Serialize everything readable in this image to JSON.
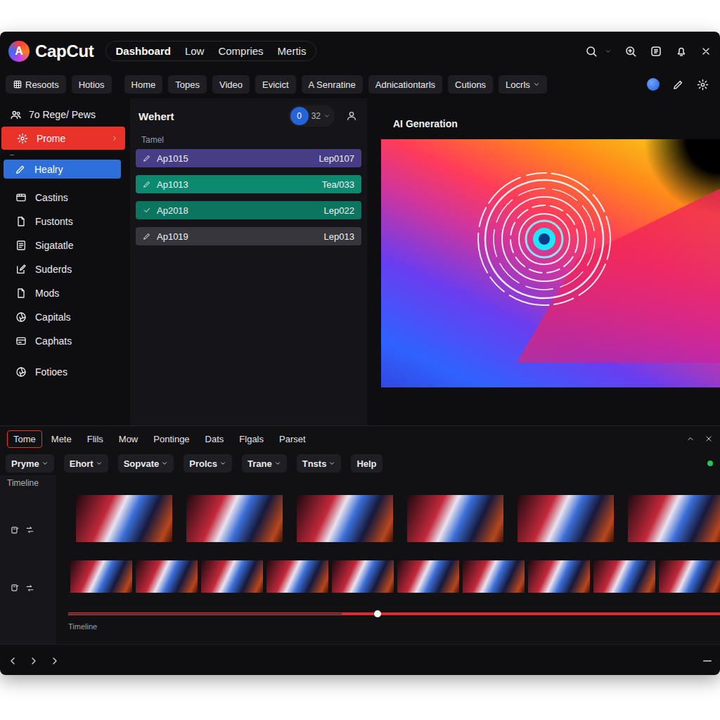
{
  "app": {
    "logo": "A",
    "name": "CapCut"
  },
  "nav": [
    {
      "label": "Dashboard",
      "selected": true
    },
    {
      "label": "Low",
      "selected": false
    },
    {
      "label": "Compries",
      "selected": false
    },
    {
      "label": "Mertis",
      "selected": false
    }
  ],
  "toolbar": [
    {
      "label": "Resoots",
      "dropdown": false
    },
    {
      "label": "Hotios",
      "dropdown": false
    },
    {
      "label": "Home",
      "dropdown": false
    },
    {
      "label": "Topes",
      "dropdown": false
    },
    {
      "label": "Video",
      "dropdown": false
    },
    {
      "label": "Evicict",
      "dropdown": false
    },
    {
      "label": "A Senratine",
      "dropdown": false
    },
    {
      "label": "Adnicationtarls",
      "dropdown": false
    },
    {
      "label": "Cutions",
      "dropdown": false
    },
    {
      "label": "Locrls",
      "dropdown": true
    }
  ],
  "sidebar": {
    "header": "7o Rege/ Pews",
    "items": [
      {
        "label": "Prome",
        "selected": true,
        "color": "#e8322a",
        "expandable": true
      },
      {
        "label": "Healry",
        "selected": true,
        "color": "#2f6fdc",
        "expandable": false
      },
      {
        "label": "Castins",
        "selected": false,
        "expandable": false
      },
      {
        "label": "Fustonts",
        "selected": false,
        "expandable": false
      },
      {
        "label": "Sigatatle",
        "selected": false,
        "expandable": false
      },
      {
        "label": "Suderds",
        "selected": false,
        "expandable": false
      },
      {
        "label": "Mods",
        "selected": false,
        "expandable": false
      },
      {
        "label": "Capitals",
        "selected": false,
        "expandable": false
      },
      {
        "label": "Caphats",
        "selected": false,
        "expandable": false
      },
      {
        "label": "Fotioes",
        "selected": false,
        "expandable": false
      }
    ]
  },
  "list": {
    "title": "Wehert",
    "badge": "0",
    "count": "32",
    "caption": "Tamel",
    "rows": [
      {
        "name": "Ap1015",
        "code": "Lep0107",
        "kind": "edit",
        "color": "#463d86"
      },
      {
        "name": "Ap1013",
        "code": "Tea/033",
        "kind": "edit",
        "color": "#0c8a70"
      },
      {
        "name": "Ap2018",
        "code": "Lep022",
        "kind": "done",
        "color": "#0b7560"
      },
      {
        "name": "Ap1019",
        "code": "Lep013",
        "kind": "edit",
        "color": "#36363c"
      }
    ]
  },
  "preview": {
    "title": "AI Generation"
  },
  "bottom_tabs": [
    {
      "label": "Tome",
      "selected": true
    },
    {
      "label": "Mete",
      "selected": false
    },
    {
      "label": "Flils",
      "selected": false
    },
    {
      "label": "Mow",
      "selected": false
    },
    {
      "label": "Pontinge",
      "selected": false
    },
    {
      "label": "Dats",
      "selected": false
    },
    {
      "label": "Flgals",
      "selected": false
    },
    {
      "label": "Parset",
      "selected": false
    }
  ],
  "menus": [
    {
      "label": "Pryme",
      "dropdown": true
    },
    {
      "label": "Ehort",
      "dropdown": true
    },
    {
      "label": "Sopvate",
      "dropdown": true
    },
    {
      "label": "Prolcs",
      "dropdown": true
    },
    {
      "label": "Trane",
      "dropdown": true
    },
    {
      "label": "Tnsts",
      "dropdown": true
    },
    {
      "label": "Help",
      "dropdown": false
    }
  ],
  "timeline": {
    "label": "Timeline",
    "caption": "Timeline",
    "level": 0.42,
    "online": true
  }
}
